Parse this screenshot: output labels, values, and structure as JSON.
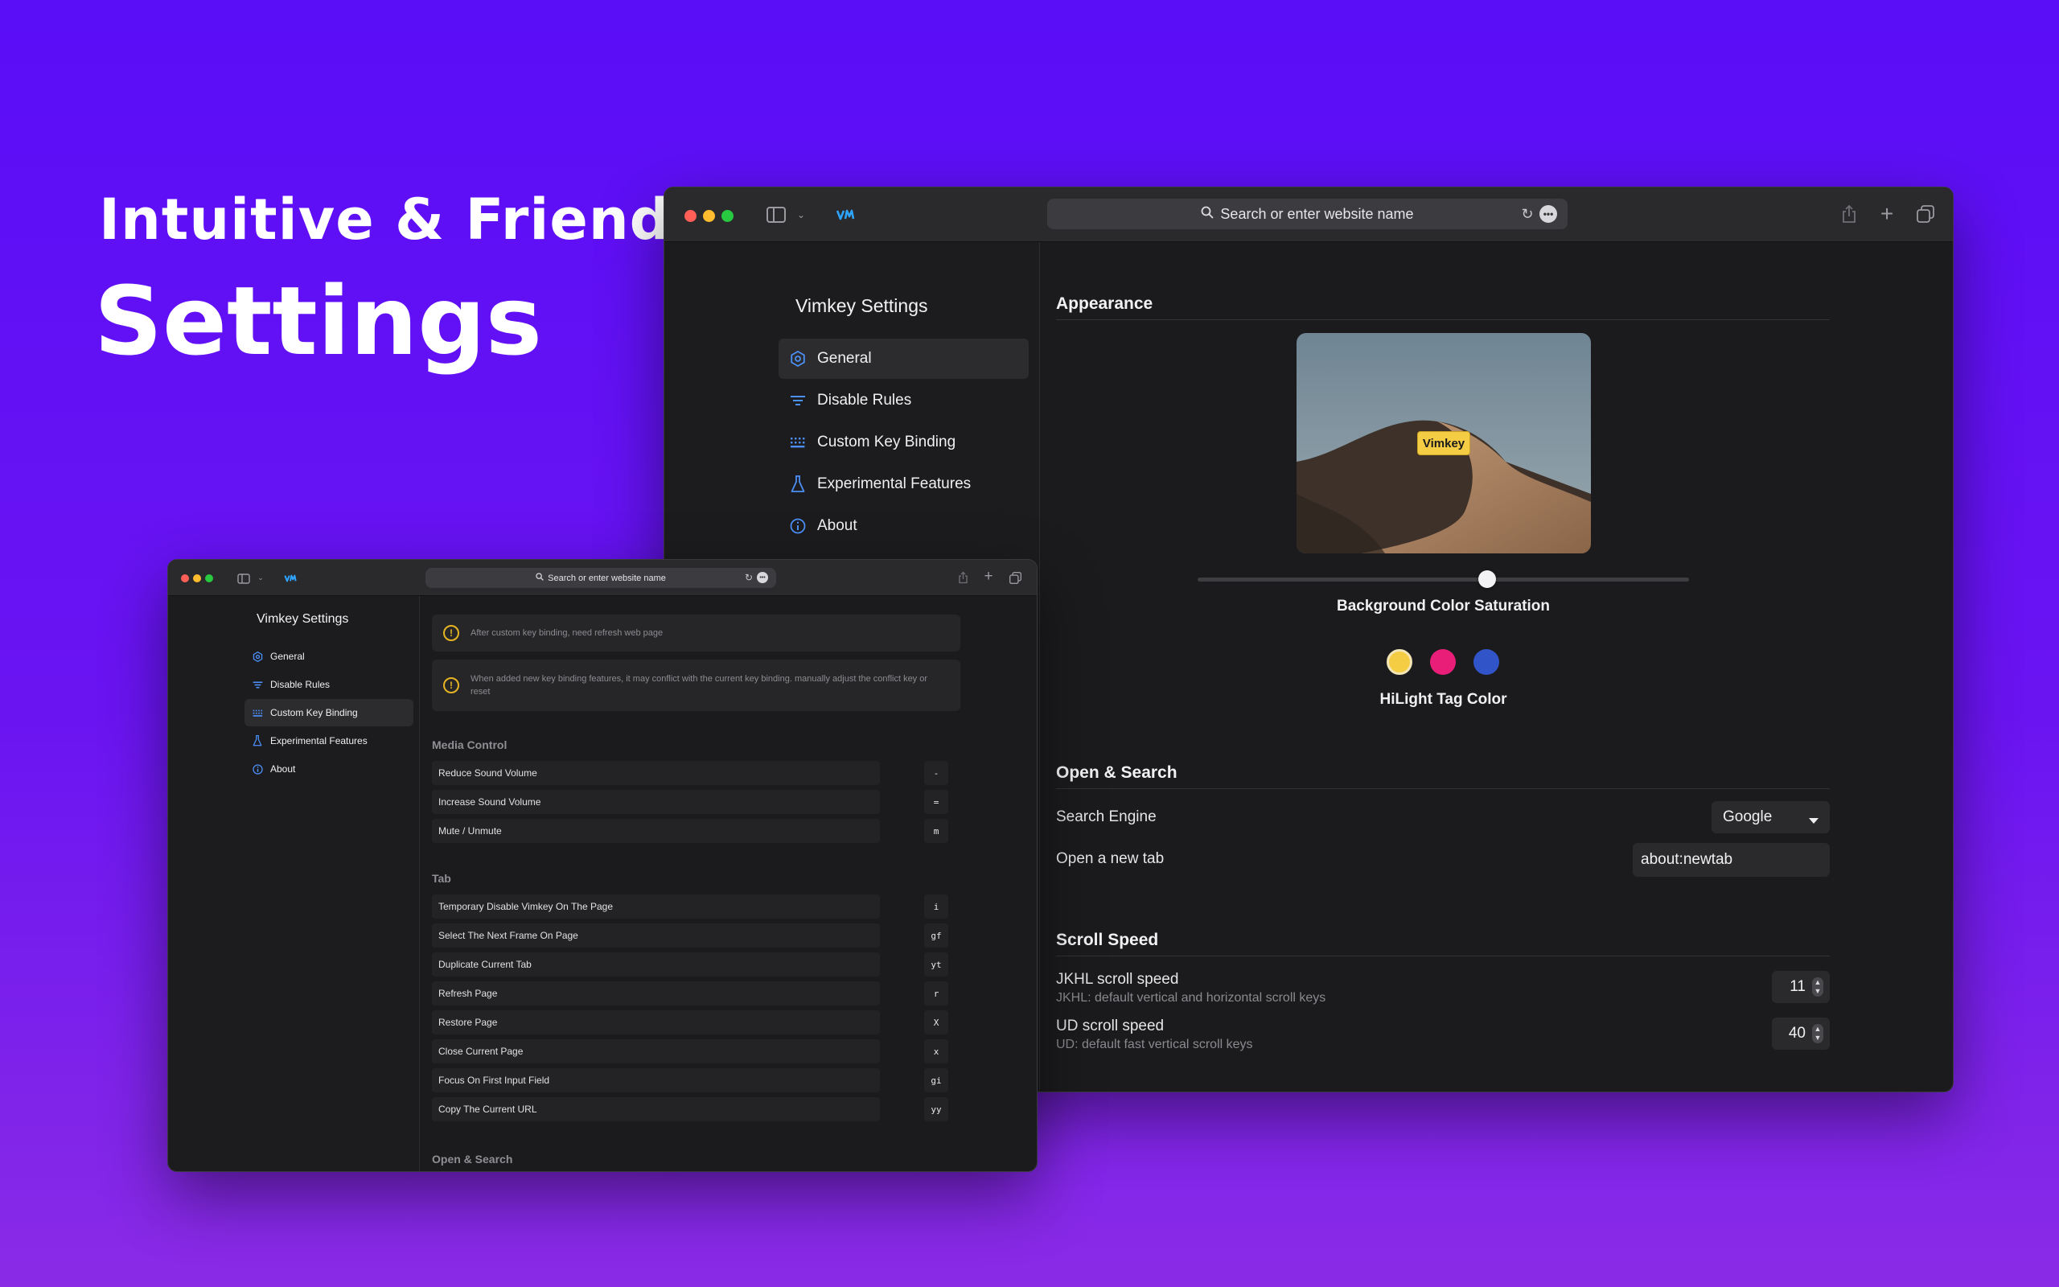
{
  "hero": {
    "line1": "Intuitive & Friendly",
    "line2": "Settings"
  },
  "main_window": {
    "address_placeholder": "Search or enter website name",
    "sidebar_title": "Vimkey Settings",
    "nav": [
      {
        "label": "General",
        "icon": "gear-icon"
      },
      {
        "label": "Disable Rules",
        "icon": "filter-icon"
      },
      {
        "label": "Custom Key Binding",
        "icon": "keyboard-icon"
      },
      {
        "label": "Experimental Features",
        "icon": "flask-icon"
      },
      {
        "label": "About",
        "icon": "info-icon"
      }
    ],
    "appearance": {
      "title": "Appearance",
      "preview_tag": "Vimkey",
      "saturation_label": "Background Color Saturation",
      "saturation_value": 0.59,
      "tag_color_label": "HiLight Tag Color",
      "tag_colors": [
        "#f5cd45",
        "#e91e78",
        "#3155c8"
      ]
    },
    "open_search": {
      "title": "Open & Search",
      "engine_label": "Search Engine",
      "engine_value": "Google",
      "newtab_label": "Open a new tab",
      "newtab_value": "about:newtab"
    },
    "scroll": {
      "title": "Scroll Speed",
      "jkhl_label": "JKHL scroll speed",
      "jkhl_desc": "JKHL: default vertical and horizontal scroll keys",
      "jkhl_value": "11",
      "ud_label": "UD scroll speed",
      "ud_desc": "UD: default fast vertical scroll keys",
      "ud_value": "40"
    }
  },
  "secondary_window": {
    "address_placeholder": "Search or enter website name",
    "sidebar_title": "Vimkey Settings",
    "nav": [
      {
        "label": "General",
        "icon": "gear-icon"
      },
      {
        "label": "Disable Rules",
        "icon": "filter-icon"
      },
      {
        "label": "Custom Key Binding",
        "icon": "keyboard-icon"
      },
      {
        "label": "Experimental Features",
        "icon": "flask-icon"
      },
      {
        "label": "About",
        "icon": "info-icon"
      }
    ],
    "notices": [
      "After custom key binding, need refresh web page",
      "When added new key binding features, it may conflict with the current key binding. manually adjust the conflict key or reset"
    ],
    "media_title": "Media Control",
    "media_rows": [
      {
        "label": "Reduce Sound Volume",
        "key": "-"
      },
      {
        "label": "Increase Sound Volume",
        "key": "="
      },
      {
        "label": "Mute / Unmute",
        "key": "m"
      }
    ],
    "tab_title": "Tab",
    "tab_rows": [
      {
        "label": "Temporary Disable Vimkey On The Page",
        "key": "i"
      },
      {
        "label": "Select The Next Frame On Page",
        "key": "gf"
      },
      {
        "label": "Duplicate Current Tab",
        "key": "yt"
      },
      {
        "label": "Refresh Page",
        "key": "r"
      },
      {
        "label": "Restore Page",
        "key": "X"
      },
      {
        "label": "Close Current Page",
        "key": "x"
      },
      {
        "label": "Focus On First Input Field",
        "key": "gi"
      },
      {
        "label": "Copy The Current URL",
        "key": "yy"
      }
    ],
    "open_search_title": "Open & Search"
  },
  "colors": {
    "close": "#ff5f57",
    "minimize": "#febc2e",
    "zoom": "#28c840",
    "accent": "#4b8ff7"
  }
}
